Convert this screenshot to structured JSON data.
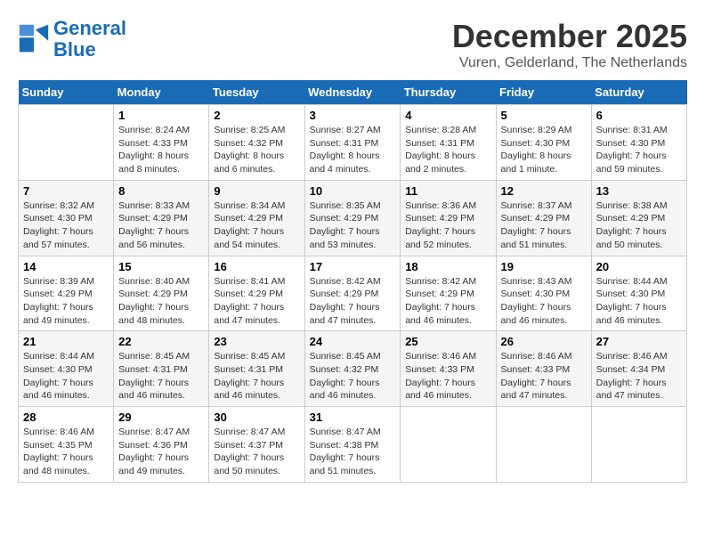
{
  "logo": {
    "line1": "General",
    "line2": "Blue"
  },
  "title": "December 2025",
  "subtitle": "Vuren, Gelderland, The Netherlands",
  "days_of_week": [
    "Sunday",
    "Monday",
    "Tuesday",
    "Wednesday",
    "Thursday",
    "Friday",
    "Saturday"
  ],
  "weeks": [
    [
      {
        "day": "",
        "info": ""
      },
      {
        "day": "1",
        "info": "Sunrise: 8:24 AM\nSunset: 4:33 PM\nDaylight: 8 hours\nand 8 minutes."
      },
      {
        "day": "2",
        "info": "Sunrise: 8:25 AM\nSunset: 4:32 PM\nDaylight: 8 hours\nand 6 minutes."
      },
      {
        "day": "3",
        "info": "Sunrise: 8:27 AM\nSunset: 4:31 PM\nDaylight: 8 hours\nand 4 minutes."
      },
      {
        "day": "4",
        "info": "Sunrise: 8:28 AM\nSunset: 4:31 PM\nDaylight: 8 hours\nand 2 minutes."
      },
      {
        "day": "5",
        "info": "Sunrise: 8:29 AM\nSunset: 4:30 PM\nDaylight: 8 hours\nand 1 minute."
      },
      {
        "day": "6",
        "info": "Sunrise: 8:31 AM\nSunset: 4:30 PM\nDaylight: 7 hours\nand 59 minutes."
      }
    ],
    [
      {
        "day": "7",
        "info": "Sunrise: 8:32 AM\nSunset: 4:30 PM\nDaylight: 7 hours\nand 57 minutes."
      },
      {
        "day": "8",
        "info": "Sunrise: 8:33 AM\nSunset: 4:29 PM\nDaylight: 7 hours\nand 56 minutes."
      },
      {
        "day": "9",
        "info": "Sunrise: 8:34 AM\nSunset: 4:29 PM\nDaylight: 7 hours\nand 54 minutes."
      },
      {
        "day": "10",
        "info": "Sunrise: 8:35 AM\nSunset: 4:29 PM\nDaylight: 7 hours\nand 53 minutes."
      },
      {
        "day": "11",
        "info": "Sunrise: 8:36 AM\nSunset: 4:29 PM\nDaylight: 7 hours\nand 52 minutes."
      },
      {
        "day": "12",
        "info": "Sunrise: 8:37 AM\nSunset: 4:29 PM\nDaylight: 7 hours\nand 51 minutes."
      },
      {
        "day": "13",
        "info": "Sunrise: 8:38 AM\nSunset: 4:29 PM\nDaylight: 7 hours\nand 50 minutes."
      }
    ],
    [
      {
        "day": "14",
        "info": "Sunrise: 8:39 AM\nSunset: 4:29 PM\nDaylight: 7 hours\nand 49 minutes."
      },
      {
        "day": "15",
        "info": "Sunrise: 8:40 AM\nSunset: 4:29 PM\nDaylight: 7 hours\nand 48 minutes."
      },
      {
        "day": "16",
        "info": "Sunrise: 8:41 AM\nSunset: 4:29 PM\nDaylight: 7 hours\nand 47 minutes."
      },
      {
        "day": "17",
        "info": "Sunrise: 8:42 AM\nSunset: 4:29 PM\nDaylight: 7 hours\nand 47 minutes."
      },
      {
        "day": "18",
        "info": "Sunrise: 8:42 AM\nSunset: 4:29 PM\nDaylight: 7 hours\nand 46 minutes."
      },
      {
        "day": "19",
        "info": "Sunrise: 8:43 AM\nSunset: 4:30 PM\nDaylight: 7 hours\nand 46 minutes."
      },
      {
        "day": "20",
        "info": "Sunrise: 8:44 AM\nSunset: 4:30 PM\nDaylight: 7 hours\nand 46 minutes."
      }
    ],
    [
      {
        "day": "21",
        "info": "Sunrise: 8:44 AM\nSunset: 4:30 PM\nDaylight: 7 hours\nand 46 minutes."
      },
      {
        "day": "22",
        "info": "Sunrise: 8:45 AM\nSunset: 4:31 PM\nDaylight: 7 hours\nand 46 minutes."
      },
      {
        "day": "23",
        "info": "Sunrise: 8:45 AM\nSunset: 4:31 PM\nDaylight: 7 hours\nand 46 minutes."
      },
      {
        "day": "24",
        "info": "Sunrise: 8:45 AM\nSunset: 4:32 PM\nDaylight: 7 hours\nand 46 minutes."
      },
      {
        "day": "25",
        "info": "Sunrise: 8:46 AM\nSunset: 4:33 PM\nDaylight: 7 hours\nand 46 minutes."
      },
      {
        "day": "26",
        "info": "Sunrise: 8:46 AM\nSunset: 4:33 PM\nDaylight: 7 hours\nand 47 minutes."
      },
      {
        "day": "27",
        "info": "Sunrise: 8:46 AM\nSunset: 4:34 PM\nDaylight: 7 hours\nand 47 minutes."
      }
    ],
    [
      {
        "day": "28",
        "info": "Sunrise: 8:46 AM\nSunset: 4:35 PM\nDaylight: 7 hours\nand 48 minutes."
      },
      {
        "day": "29",
        "info": "Sunrise: 8:47 AM\nSunset: 4:36 PM\nDaylight: 7 hours\nand 49 minutes."
      },
      {
        "day": "30",
        "info": "Sunrise: 8:47 AM\nSunset: 4:37 PM\nDaylight: 7 hours\nand 50 minutes."
      },
      {
        "day": "31",
        "info": "Sunrise: 8:47 AM\nSunset: 4:38 PM\nDaylight: 7 hours\nand 51 minutes."
      },
      {
        "day": "",
        "info": ""
      },
      {
        "day": "",
        "info": ""
      },
      {
        "day": "",
        "info": ""
      }
    ]
  ]
}
